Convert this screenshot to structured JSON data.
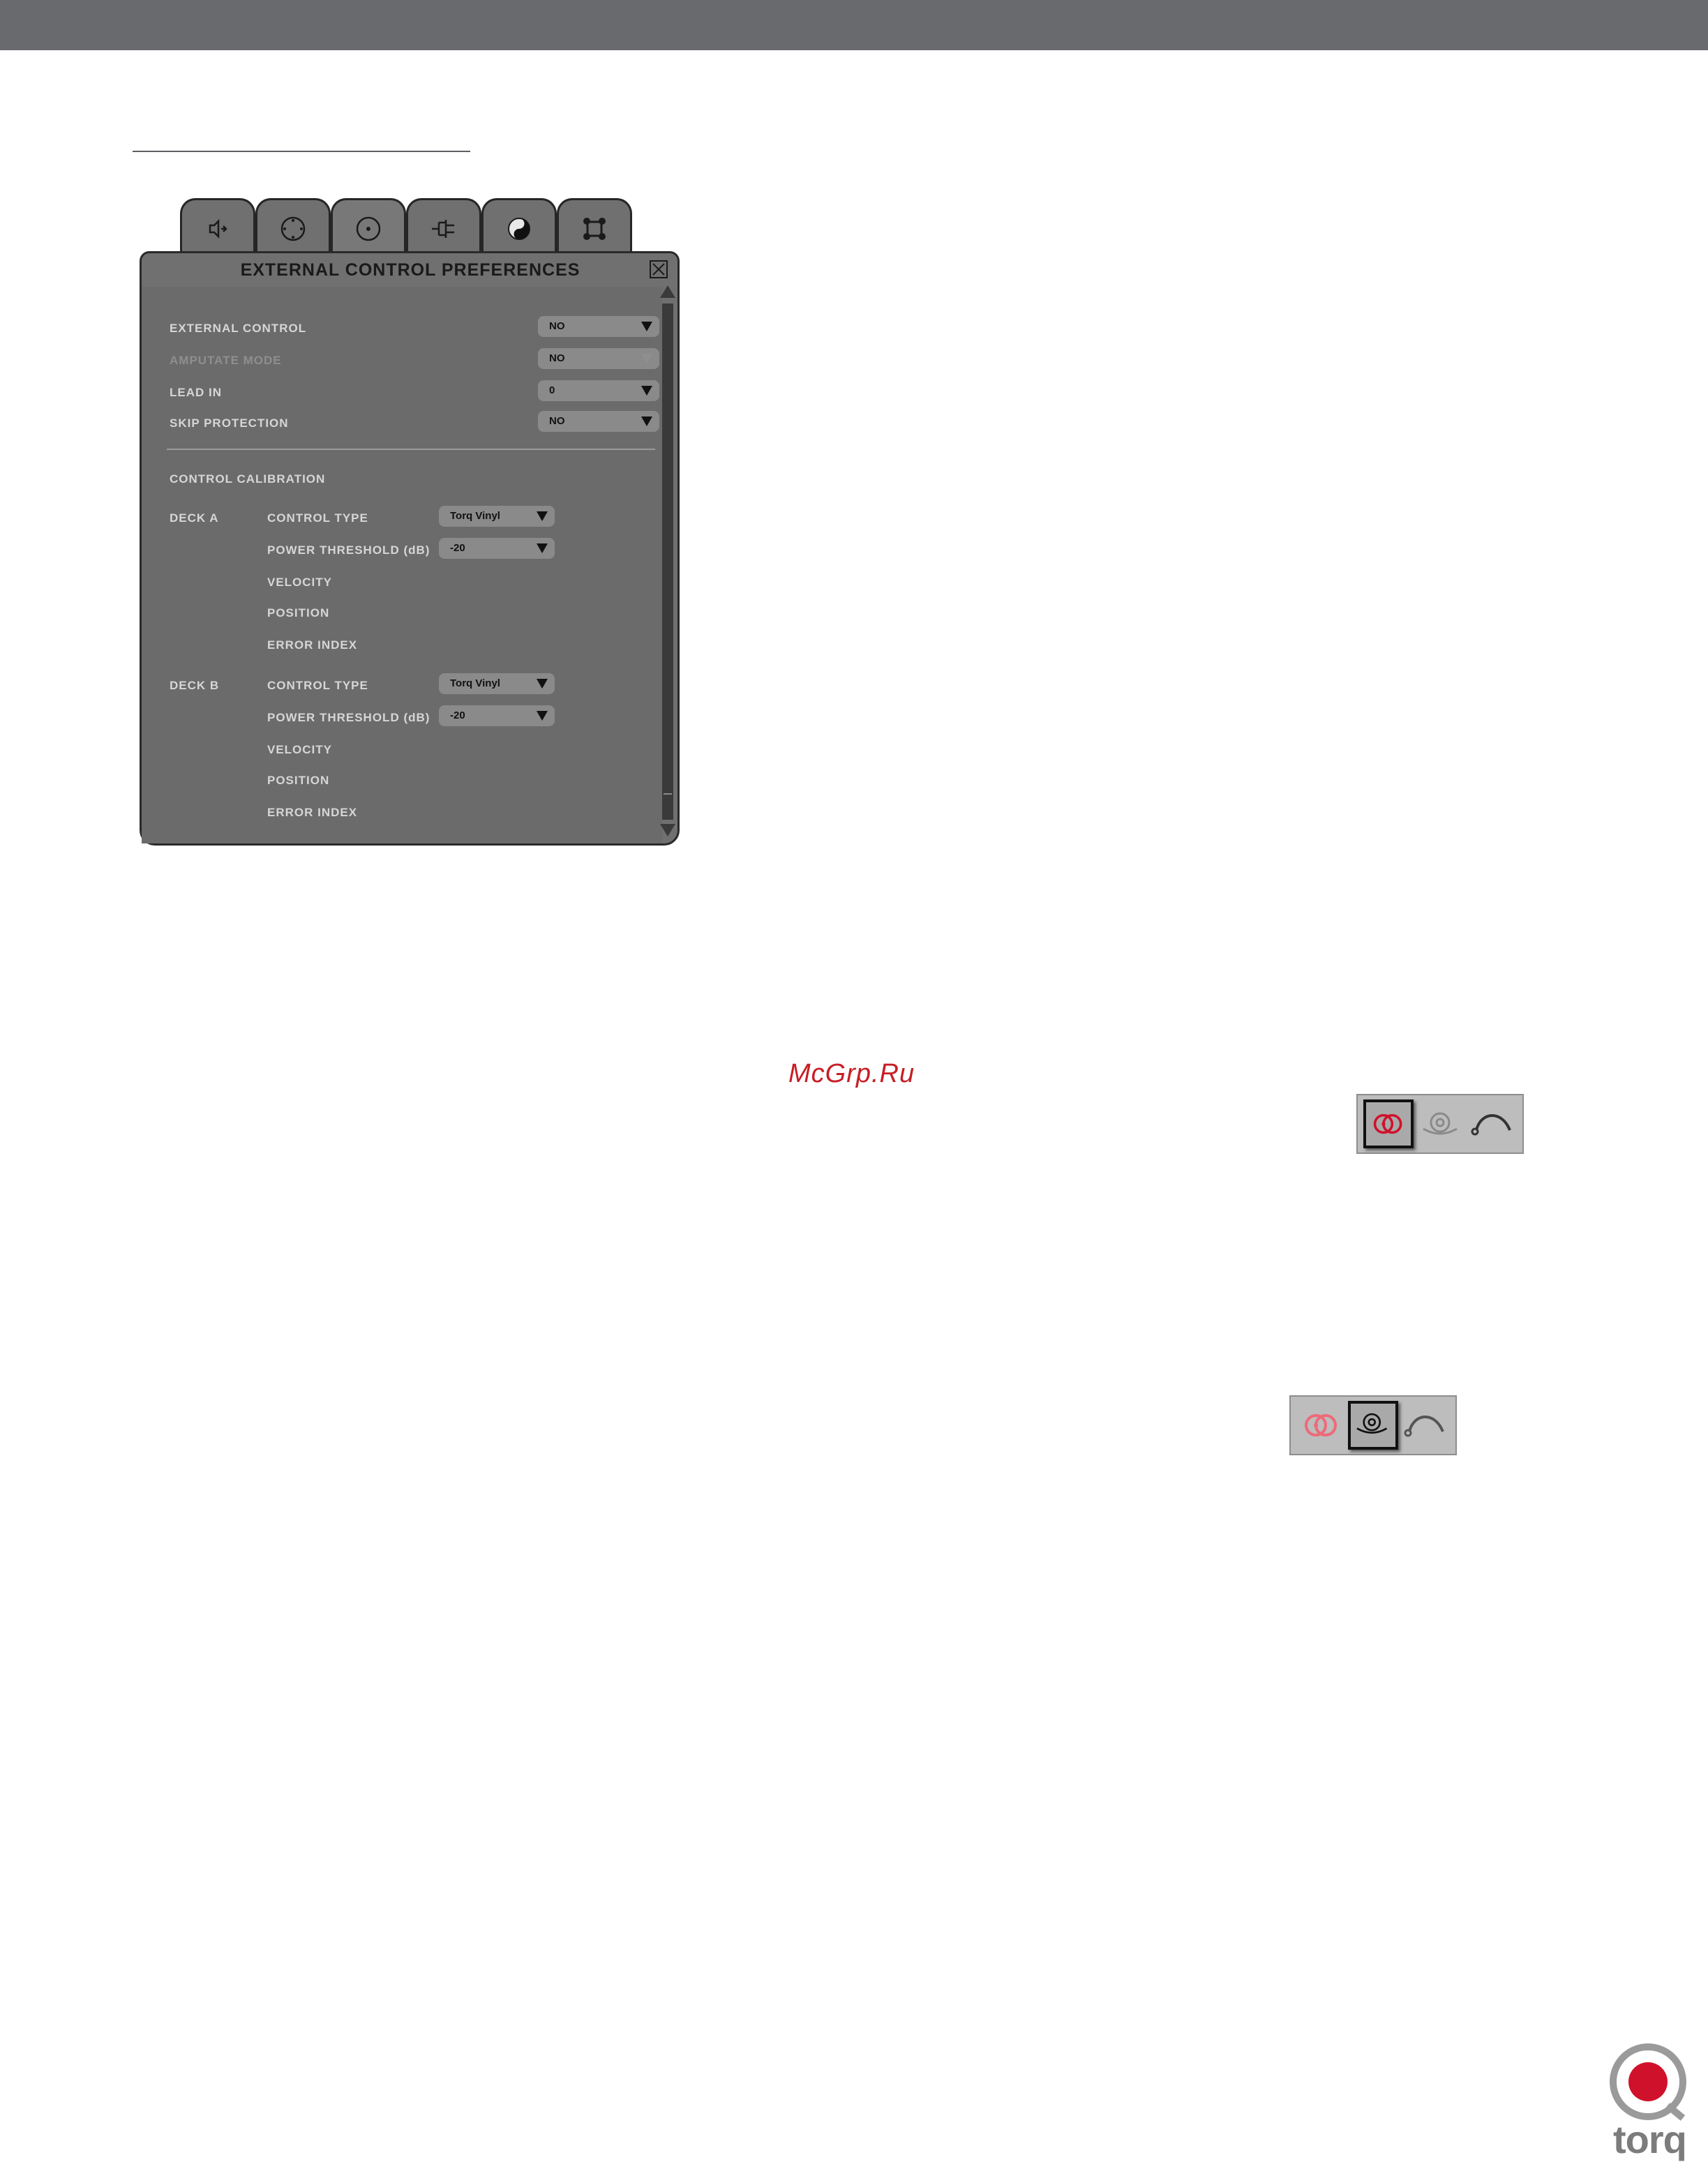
{
  "window": {
    "title": "EXTERNAL CONTROL PREFERENCES",
    "tabs": [
      {
        "icon": "speaker-icon"
      },
      {
        "icon": "dial-icon"
      },
      {
        "icon": "disc-icon"
      },
      {
        "icon": "plug-icon"
      },
      {
        "icon": "yin-yang-icon"
      },
      {
        "icon": "network-icon"
      }
    ]
  },
  "settings": {
    "external_control": {
      "label": "EXTERNAL CONTROL",
      "value": "NO"
    },
    "amputate_mode": {
      "label": "AMPUTATE MODE",
      "value": "NO"
    },
    "lead_in": {
      "label": "LEAD IN",
      "value": "0"
    },
    "skip_protection": {
      "label": "SKIP PROTECTION",
      "value": "NO"
    }
  },
  "calibration": {
    "heading": "CONTROL CALIBRATION",
    "deck_a": {
      "label": "DECK A",
      "control_type_label": "CONTROL TYPE",
      "control_type_value": "Torq Vinyl",
      "power_threshold_label": "POWER THRESHOLD (dB)",
      "power_threshold_value": "-20",
      "velocity_label": "VELOCITY",
      "position_label": "POSITION",
      "error_index_label": "ERROR INDEX"
    },
    "deck_b": {
      "label": "DECK B",
      "control_type_label": "CONTROL TYPE",
      "control_type_value": "Torq Vinyl",
      "power_threshold_label": "POWER THRESHOLD (dB)",
      "power_threshold_value": "-20",
      "velocity_label": "VELOCITY",
      "position_label": "POSITION",
      "error_index_label": "ERROR INDEX"
    }
  },
  "watermark": "McGrp.Ru",
  "mode_buttons_1": {
    "active": "absolute-mode-icon",
    "icons": [
      "absolute-mode-icon",
      "relative-mode-icon",
      "internal-mode-icon"
    ]
  },
  "mode_buttons_2": {
    "active": "relative-mode-icon",
    "icons": [
      "absolute-mode-icon",
      "relative-mode-icon",
      "internal-mode-icon"
    ]
  },
  "brand": {
    "name": "torq",
    "accent": "#d0112b"
  }
}
